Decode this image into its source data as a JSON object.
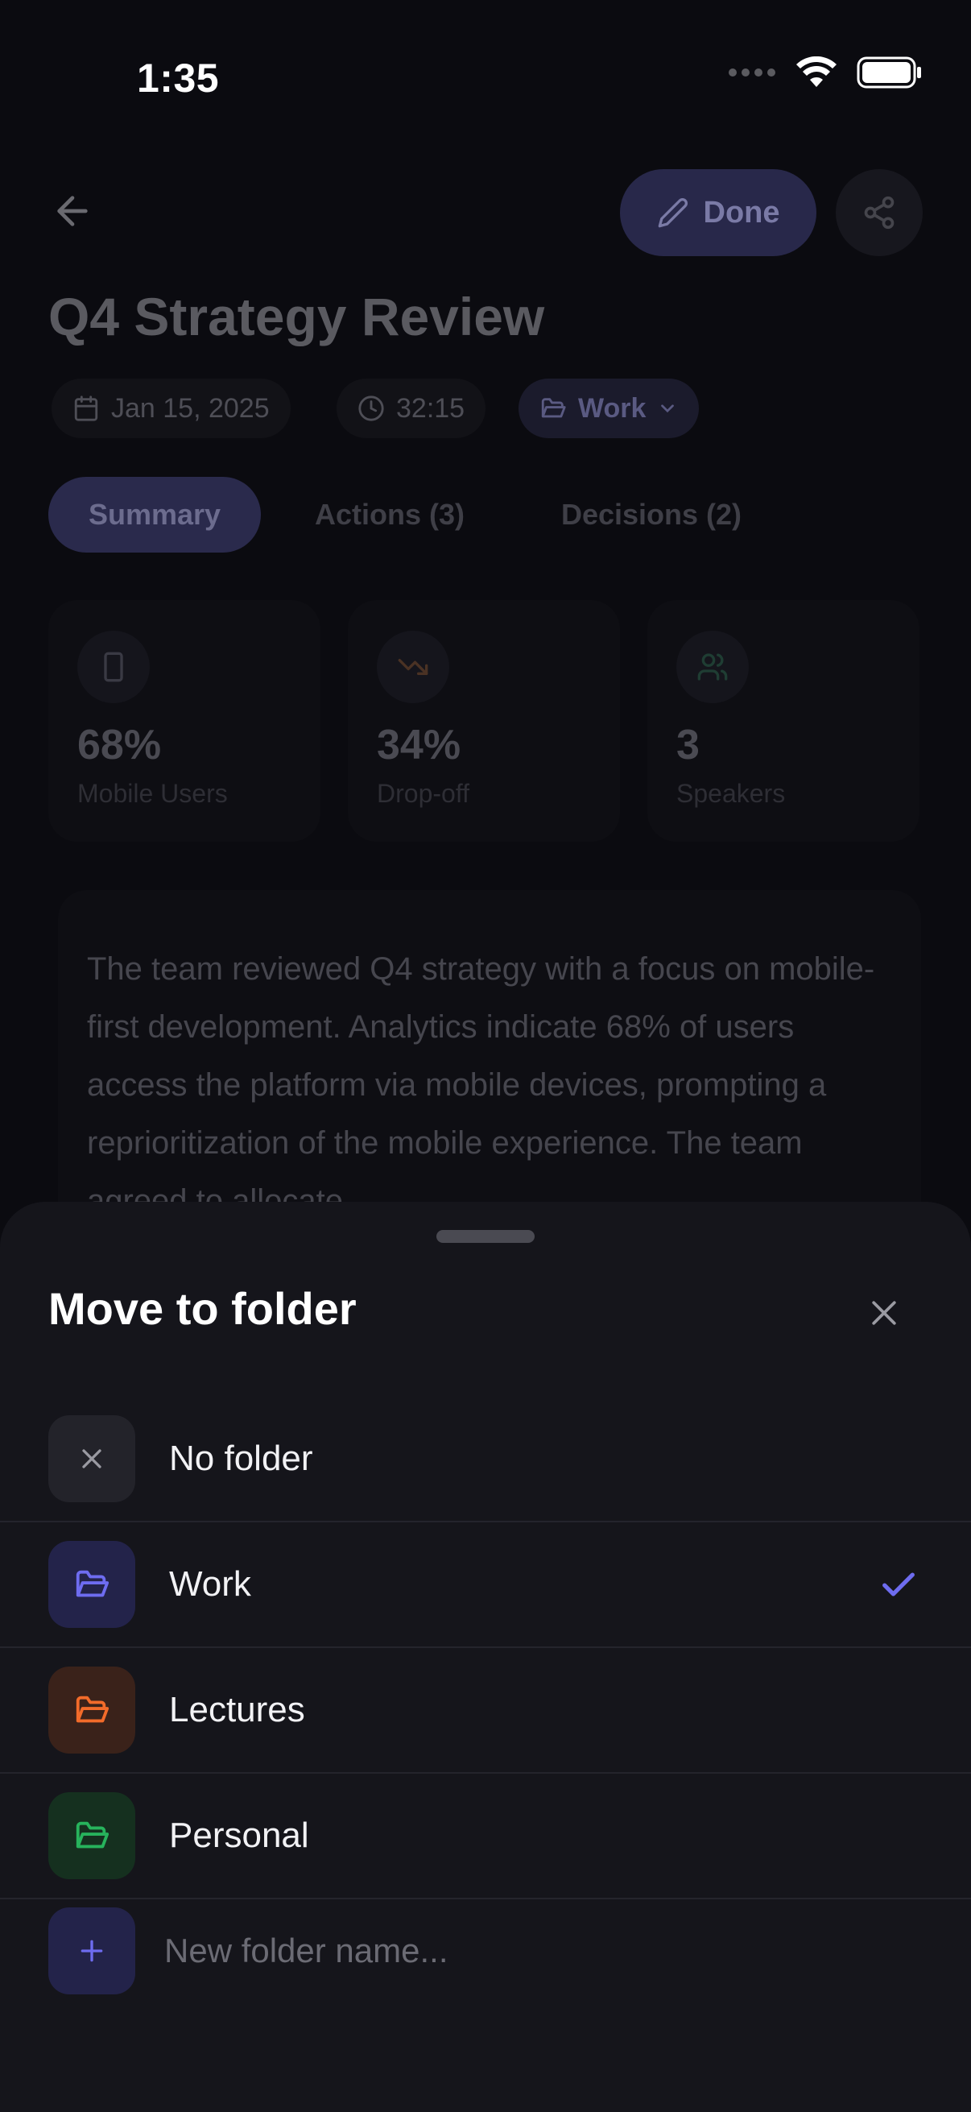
{
  "status_bar": {
    "time": "1:35"
  },
  "header": {
    "done_label": "Done"
  },
  "page": {
    "title": "Q4 Strategy Review",
    "meta": {
      "date": "Jan 15, 2025",
      "duration": "32:15",
      "folder": "Work"
    },
    "tabs": [
      {
        "label": "Summary",
        "active": true
      },
      {
        "label": "Actions (3)",
        "active": false
      },
      {
        "label": "Decisions (2)",
        "active": false
      }
    ],
    "stats": [
      {
        "value": "68%",
        "label": "Mobile Users",
        "icon": "smartphone-icon"
      },
      {
        "value": "34%",
        "label": "Drop-off",
        "icon": "trending-down-icon"
      },
      {
        "value": "3",
        "label": "Speakers",
        "icon": "users-icon"
      }
    ],
    "summary_text": "The team reviewed Q4 strategy with a focus on mobile-first development. Analytics indicate 68% of users access the platform via mobile devices, prompting a reprioritization of the mobile experience. The team agreed to allocate"
  },
  "sheet": {
    "title": "Move to folder",
    "options": [
      {
        "label": "No folder",
        "icon": "x-icon",
        "selected": false
      },
      {
        "label": "Work",
        "icon": "folder-open-icon",
        "selected": true
      },
      {
        "label": "Lectures",
        "icon": "folder-open-icon",
        "selected": false
      },
      {
        "label": "Personal",
        "icon": "folder-open-icon",
        "selected": false
      }
    ],
    "new_folder_placeholder": "New folder name..."
  },
  "colors": {
    "accent": "#6e6cf0",
    "work": "#6e6cf0",
    "lectures": "#f26b2a",
    "personal": "#27b35c",
    "sheet_bg": "#15151b"
  }
}
